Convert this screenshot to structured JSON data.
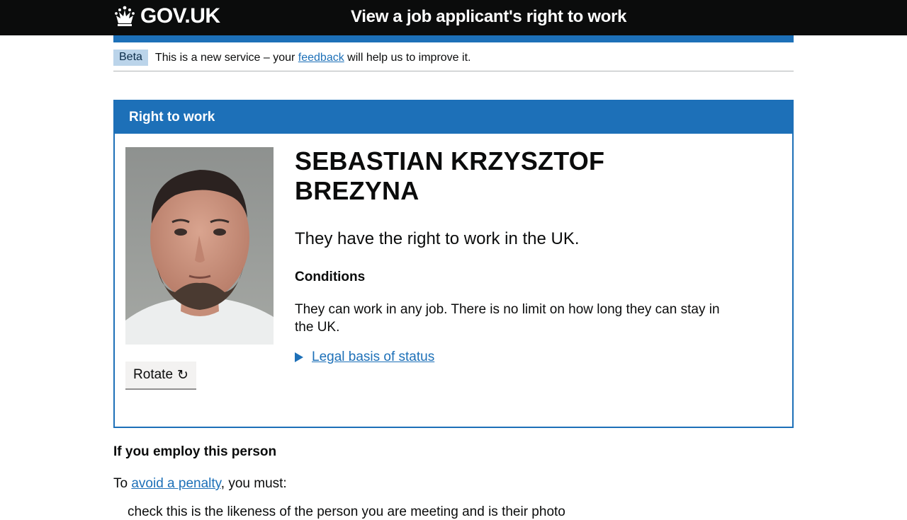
{
  "header": {
    "logo_text": "GOV.UK",
    "service_name": "View a job applicant's right to work"
  },
  "phase_banner": {
    "tag": "Beta",
    "text_before": "This is a new service – your ",
    "link": "feedback",
    "text_after": " will help us to improve it."
  },
  "panel": {
    "title": "Right to work",
    "name": "SEBASTIAN KRZYSZTOF BREZYNA",
    "status": "They have the right to work in the UK.",
    "conditions_heading": "Conditions",
    "conditions_text": "They can work in any job. There is no limit on how long they can stay in the UK.",
    "legal_basis_link": "Legal basis of status",
    "rotate_label": "Rotate",
    "rotate_icon": "↻"
  },
  "employ": {
    "heading": "If you employ this person",
    "text_before": "To ",
    "link": "avoid a penalty",
    "text_after": ", you must:",
    "first_item": "check this is the likeness of the person you are meeting and is their photo"
  },
  "colors": {
    "header_bg": "#0b0c0c",
    "brand_blue": "#1d70b8",
    "tag_bg": "#bbd4ea",
    "button_bg": "#f3f2f1"
  }
}
